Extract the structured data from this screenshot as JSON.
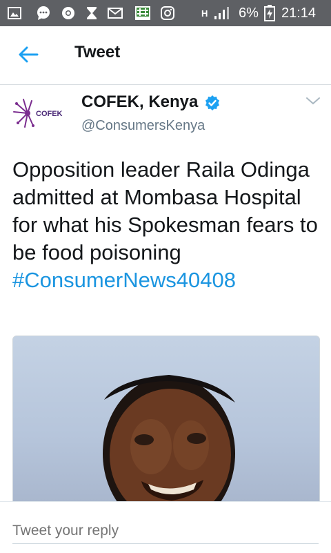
{
  "status_bar": {
    "battery_percent": "6%",
    "time": "21:14",
    "network": "H",
    "icons": [
      "gallery-icon",
      "chat-icon",
      "chrome-icon",
      "hourglass-icon",
      "gmail-icon",
      "app-icon",
      "instagram-icon",
      "signal-icon",
      "battery-charging-icon"
    ]
  },
  "header": {
    "title": "Tweet",
    "back_icon": "arrow-left-icon"
  },
  "tweet": {
    "author_name": "COFEK, Kenya",
    "handle": "@ConsumersKenya",
    "avatar_text": "COFEK",
    "verified": true,
    "text": "Opposition leader Raila Odinga admitted at Mombasa Hospital for what his Spokesman fears to be food poisoning",
    "hashtag": "#ConsumerNews40408",
    "media_description": "photo"
  },
  "reply": {
    "placeholder": "Tweet your reply"
  },
  "colors": {
    "accent": "#1da1f2",
    "hashtag": "#1b95e0",
    "status_bar": "#5e6064",
    "muted": "#657786"
  }
}
